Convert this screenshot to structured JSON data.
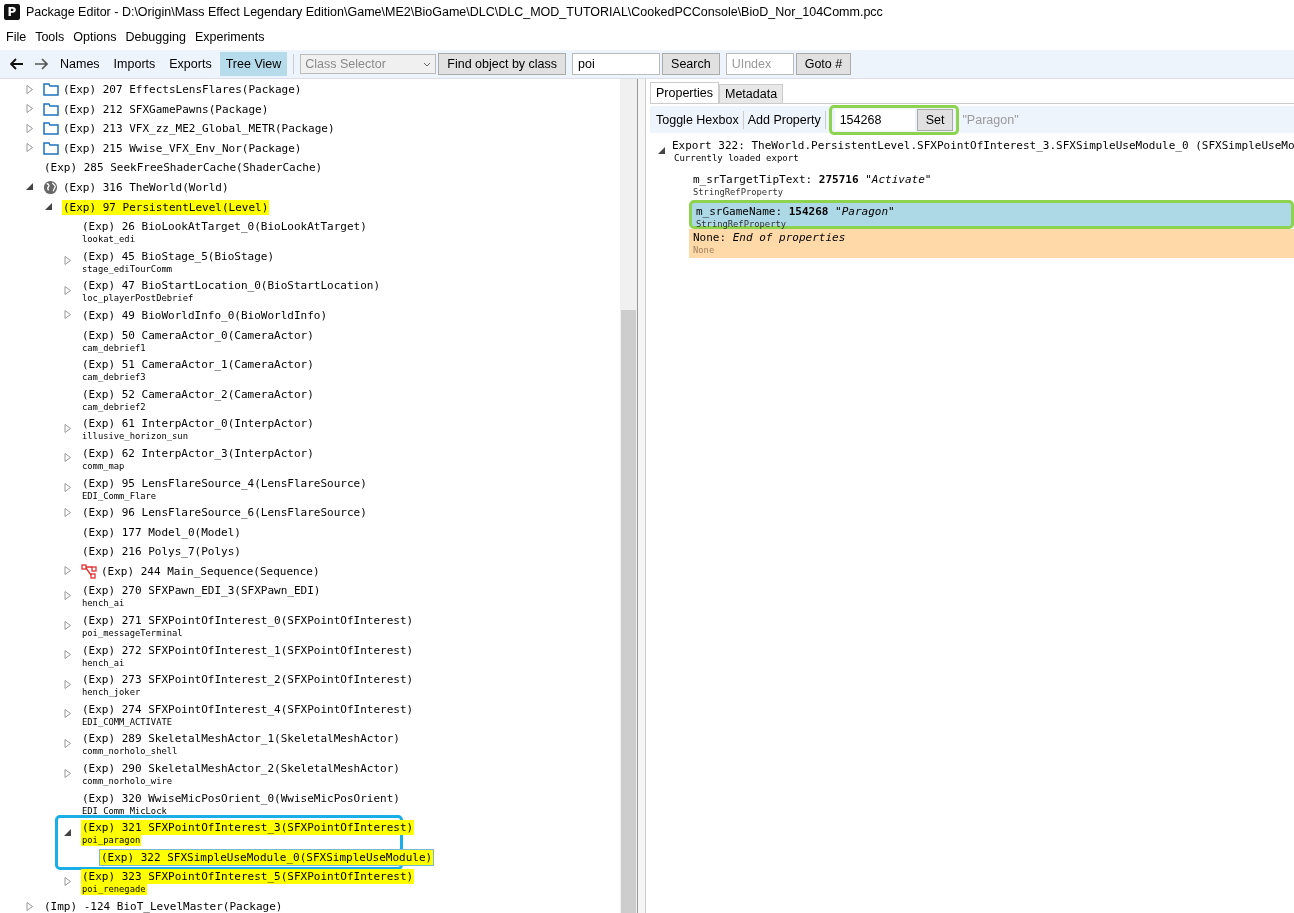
{
  "window": {
    "icon_letter": "P",
    "title": "Package Editor - D:\\Origin\\Mass Effect Legendary Edition\\Game\\ME2\\BioGame\\DLC\\DLC_MOD_TUTORIAL\\CookedPCConsole\\BioD_Nor_104Comm.pcc"
  },
  "menu": [
    "File",
    "Tools",
    "Options",
    "Debugging",
    "Experiments"
  ],
  "toolbar": {
    "views": [
      {
        "label": "Names",
        "selected": false
      },
      {
        "label": "Imports",
        "selected": false
      },
      {
        "label": "Exports",
        "selected": false
      },
      {
        "label": "Tree View",
        "selected": true
      }
    ],
    "class_selector": {
      "placeholder": "Class Selector"
    },
    "find_button": "Find object by class",
    "search": {
      "value": "poi"
    },
    "search_button": "Search",
    "uindex": {
      "placeholder": "UIndex"
    },
    "goto_button": "Goto #"
  },
  "tree": [
    {
      "label": "(Exp) 207 EffectsLensFlares(Package)",
      "kind": "folder",
      "expanded": false,
      "highlighted": false,
      "selected": false
    },
    {
      "label": "(Exp) 212 SFXGamePawns(Package)",
      "kind": "folder",
      "expanded": false,
      "highlighted": false,
      "selected": false
    },
    {
      "label": "(Exp) 213 VFX_zz_ME2_Global_METR(Package)",
      "kind": "folder",
      "expanded": false,
      "highlighted": false,
      "selected": false
    },
    {
      "label": "(Exp) 215 Wwise_VFX_Env_Nor(Package)",
      "kind": "folder",
      "expanded": false,
      "highlighted": false,
      "selected": false
    },
    {
      "label": "(Exp) 285 SeekFreeShaderCache(ShaderCache)",
      "highlighted": false,
      "selected": false
    },
    {
      "label": "(Exp) 316 TheWorld(World)",
      "kind": "world",
      "expanded": true,
      "highlighted": false,
      "selected": false,
      "children": [
        {
          "label": "(Exp) 97 PersistentLevel(Level)",
          "expanded": true,
          "highlighted": true,
          "selected": false,
          "children": [
            {
              "label": "(Exp) 26 BioLookAtTarget_0(BioLookAtTarget)",
              "sub": "lookat_edi",
              "highlighted": false,
              "selected": false
            },
            {
              "label": "(Exp) 45 BioStage_5(BioStage)",
              "sub": "stage_ediTourComm",
              "expanded": false,
              "highlighted": false,
              "selected": false
            },
            {
              "label": "(Exp) 47 BioStartLocation_0(BioStartLocation)",
              "sub": "loc_playerPostDebrief",
              "expanded": false,
              "highlighted": false,
              "selected": false
            },
            {
              "label": "(Exp) 49 BioWorldInfo_0(BioWorldInfo)",
              "expanded": false,
              "highlighted": false,
              "selected": false
            },
            {
              "label": "(Exp) 50 CameraActor_0(CameraActor)",
              "sub": "cam_debrief1",
              "highlighted": false,
              "selected": false
            },
            {
              "label": "(Exp) 51 CameraActor_1(CameraActor)",
              "sub": "cam_debrief3",
              "highlighted": false,
              "selected": false
            },
            {
              "label": "(Exp) 52 CameraActor_2(CameraActor)",
              "sub": "cam_debrief2",
              "highlighted": false,
              "selected": false
            },
            {
              "label": "(Exp) 61 InterpActor_0(InterpActor)",
              "sub": "illusive_horizon_sun",
              "expanded": false,
              "highlighted": false,
              "selected": false
            },
            {
              "label": "(Exp) 62 InterpActor_3(InterpActor)",
              "sub": "comm_map",
              "expanded": false,
              "highlighted": false,
              "selected": false
            },
            {
              "label": "(Exp) 95 LensFlareSource_4(LensFlareSource)",
              "sub": "EDI_Comm_Flare",
              "expanded": false,
              "highlighted": false,
              "selected": false
            },
            {
              "label": "(Exp) 96 LensFlareSource_6(LensFlareSource)",
              "expanded": false,
              "highlighted": false,
              "selected": false
            },
            {
              "label": "(Exp) 177 Model_0(Model)",
              "highlighted": false,
              "selected": false
            },
            {
              "label": "(Exp) 216 Polys_7(Polys)",
              "highlighted": false,
              "selected": false
            },
            {
              "label": "(Exp) 244 Main_Sequence(Sequence)",
              "kind": "sequence",
              "expanded": false,
              "highlighted": false,
              "selected": false
            },
            {
              "label": "(Exp) 270 SFXPawn_EDI_3(SFXPawn_EDI)",
              "sub": "hench_ai",
              "expanded": false,
              "highlighted": false,
              "selected": false
            },
            {
              "label": "(Exp) 271 SFXPointOfInterest_0(SFXPointOfInterest)",
              "sub": "poi_messageTerminal",
              "expanded": false,
              "highlighted": false,
              "selected": false
            },
            {
              "label": "(Exp) 272 SFXPointOfInterest_1(SFXPointOfInterest)",
              "sub": "hench_ai",
              "expanded": false,
              "highlighted": false,
              "selected": false
            },
            {
              "label": "(Exp) 273 SFXPointOfInterest_2(SFXPointOfInterest)",
              "sub": "hench_joker",
              "expanded": false,
              "highlighted": false,
              "selected": false
            },
            {
              "label": "(Exp) 274 SFXPointOfInterest_4(SFXPointOfInterest)",
              "sub": "EDI_COMM_ACTIVATE",
              "expanded": false,
              "highlighted": false,
              "selected": false
            },
            {
              "label": "(Exp) 289 SkeletalMeshActor_1(SkeletalMeshActor)",
              "sub": "comm_norholo_shell",
              "expanded": false,
              "highlighted": false,
              "selected": false
            },
            {
              "label": "(Exp) 290 SkeletalMeshActor_2(SkeletalMeshActor)",
              "sub": "comm_norholo_wire",
              "expanded": false,
              "highlighted": false,
              "selected": false
            },
            {
              "label": "(Exp) 320 WwiseMicPosOrient_0(WwiseMicPosOrient)",
              "sub": "EDI_Comm_MicLock",
              "highlighted": false,
              "selected": false
            },
            {
              "label": "(Exp) 321 SFXPointOfInterest_3(SFXPointOfInterest)",
              "sub": "poi_paragon",
              "expanded": true,
              "highlighted": true,
              "selected": false,
              "callout": true,
              "children": [
                {
                  "label": "(Exp) 322 SFXSimpleUseModule_0(SFXSimpleUseModule)",
                  "highlighted": true,
                  "selected": true
                }
              ]
            },
            {
              "label": "(Exp) 323 SFXPointOfInterest_5(SFXPointOfInterest)",
              "sub": "poi_renegade",
              "expanded": false,
              "highlighted": true,
              "selected": false
            }
          ]
        }
      ]
    },
    {
      "label": "(Imp) -124 BioT_LevelMaster(Package)",
      "expanded": false,
      "highlighted": false,
      "selected": false
    }
  ],
  "inspector": {
    "tabs": [
      {
        "label": "Properties",
        "selected": true
      },
      {
        "label": "Metadata",
        "selected": false
      }
    ],
    "toolbar": {
      "buttons": [
        "Toggle Hexbox",
        "Add Property"
      ],
      "value": {
        "value": "154268",
        "callout": true
      },
      "set_button": "Set",
      "preview": "\"Paragon\""
    },
    "export": {
      "header": "Export 322: TheWorld.PersistentLevel.SFXPointOfInterest_3.SFXSimpleUseModule_0 (SFXSimpleUseMo",
      "sub": "Currently loaded export"
    },
    "properties": [
      {
        "kind": "property",
        "text": "m_srTargetTipText: **275716** *\"Activate\"*",
        "type": "StringRefProperty",
        "selected": false,
        "callout": false
      },
      {
        "kind": "property",
        "text": "m_srGameName: **154268** *\"Paragon\"*",
        "type": "StringRefProperty",
        "selected": true,
        "callout": true
      },
      {
        "kind": "end",
        "text": "None: *End of properties*",
        "type": "None",
        "selected": false,
        "callout": false
      }
    ]
  }
}
